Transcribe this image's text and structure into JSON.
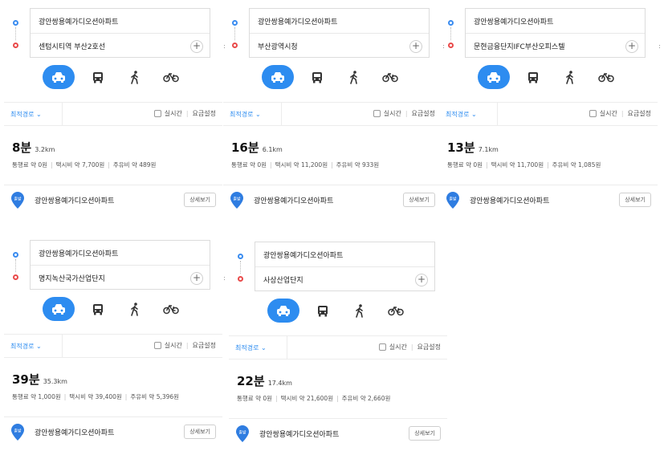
{
  "panels": [
    {
      "origin": "광안쌍용예가디오션아파트",
      "destination": "센텀시티역 부산2호선",
      "options": {
        "best_route": "최적경로",
        "realtime": "실시간",
        "fare_settings": "요금설정"
      },
      "time": "8분",
      "distance": "3.2km",
      "toll": "통행료 약 0원",
      "taxi": "택시비 약 7,700원",
      "fuel": "주유비 약 489원",
      "start_badge": "출발",
      "start_name": "광안쌍용예가디오션아파트",
      "detail_button": "상세보기"
    },
    {
      "origin": "광안쌍용예가디오션아파트",
      "destination": "부산광역시청",
      "options": {
        "best_route": "최적경로",
        "realtime": "실시간",
        "fare_settings": "요금설정"
      },
      "time": "16분",
      "distance": "6.1km",
      "toll": "통행료 약 0원",
      "taxi": "택시비 약 11,200원",
      "fuel": "주유비 약 933원",
      "start_badge": "출발",
      "start_name": "광안쌍용예가디오션아파트",
      "detail_button": "상세보기"
    },
    {
      "origin": "광안쌍용예가디오션아파트",
      "destination": "문현금융단지IFC부산오피스텔",
      "options": {
        "best_route": "최적경로",
        "realtime": "실시간",
        "fare_settings": "요금설정"
      },
      "time": "13분",
      "distance": "7.1km",
      "toll": "통행료 약 0원",
      "taxi": "택시비 약 11,700원",
      "fuel": "주유비 약 1,085원",
      "start_badge": "출발",
      "start_name": "광안쌍용예가디오션아파트",
      "detail_button": "상세보기"
    },
    {
      "origin": "광안쌍용예가디오션아파트",
      "destination": "명지녹산국가산업단지",
      "options": {
        "best_route": "최적경로",
        "realtime": "실시간",
        "fare_settings": "요금설정"
      },
      "time": "39분",
      "distance": "35.3km",
      "toll": "통행료 약 1,000원",
      "taxi": "택시비 약 39,400원",
      "fuel": "주유비 약 5,396원",
      "start_badge": "출발",
      "start_name": "광안쌍용예가디오션아파트",
      "detail_button": "상세보기"
    },
    {
      "origin": "광안쌍용예가디오션아파트",
      "destination": "사상산업단지",
      "options": {
        "best_route": "최적경로",
        "realtime": "실시간",
        "fare_settings": "요금설정"
      },
      "time": "22분",
      "distance": "17.4km",
      "toll": "통행료 약 0원",
      "taxi": "택시비 약 21,600원",
      "fuel": "주유비 약 2,660원",
      "start_badge": "출발",
      "start_name": "광안쌍용예가디오션아파트",
      "detail_button": "상세보기"
    }
  ],
  "add_symbol": "+",
  "chevron": "⌄",
  "edge_marks": [
    ":",
    ":",
    ":",
    ":"
  ],
  "mode_icons": [
    "car-icon",
    "bus-icon",
    "walk-icon",
    "bike-icon"
  ],
  "colors": {
    "accent": "#2d8cf0",
    "start": "#3a8cf0",
    "end": "#e94a4a",
    "pin": "#2f7de1"
  }
}
